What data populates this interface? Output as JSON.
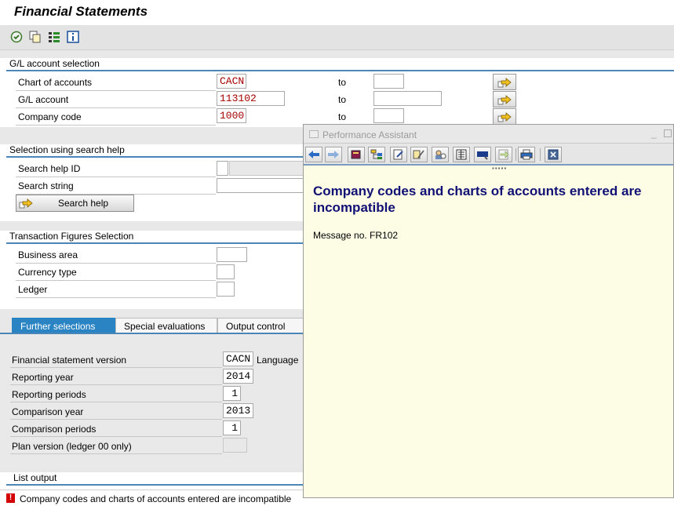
{
  "window": {
    "title": "Financial Statements"
  },
  "toolbar": {
    "icons": [
      "execute-icon",
      "copy-variant-icon",
      "tree-list-icon",
      "info-icon"
    ]
  },
  "gl_selection": {
    "title": "G/L account selection",
    "to_label": "to",
    "rows": [
      {
        "label": "Chart of accounts",
        "value": "CACN",
        "to_value": ""
      },
      {
        "label": "G/L account",
        "value": "113102",
        "to_value": ""
      },
      {
        "label": "Company code",
        "value": "1000",
        "to_value": ""
      }
    ]
  },
  "search_help": {
    "title": "Selection using search help",
    "id_label": "Search help ID",
    "string_label": "Search string",
    "button_label": "Search help"
  },
  "transaction_figures": {
    "title": "Transaction Figures Selection",
    "rows": [
      {
        "label": "Business area"
      },
      {
        "label": "Currency type"
      },
      {
        "label": "Ledger"
      }
    ]
  },
  "tabs": [
    {
      "label": "Further selections",
      "active": true
    },
    {
      "label": "Special evaluations",
      "active": false
    },
    {
      "label": "Output control",
      "active": false
    }
  ],
  "further_selections": {
    "language_label": "Language",
    "rows": [
      {
        "label": "Financial statement version",
        "value": "CACN"
      },
      {
        "label": "Reporting year",
        "value": "2014"
      },
      {
        "label": "Reporting periods",
        "value": "1"
      },
      {
        "label": "Comparison year",
        "value": "2013"
      },
      {
        "label": "Comparison periods",
        "value": "1"
      },
      {
        "label": "Plan version (ledger 00 only)",
        "value": ""
      }
    ]
  },
  "list_output": {
    "title": "List output"
  },
  "status_bar": {
    "icon": "error-icon",
    "text": "Company codes and charts of accounts entered are incompatible"
  },
  "performance_assistant": {
    "title": "Performance Assistant",
    "heading": "Company codes and charts of accounts entered are incompatible",
    "message_no": "Message no. FR102",
    "toolbar_icons": [
      "back-icon",
      "forward-icon",
      "book-icon",
      "tree-icon",
      "edit-icon",
      "notes-icon",
      "users-icon",
      "document-icon",
      "technical-info-icon",
      "export-icon",
      "print-icon",
      "close-icon"
    ]
  },
  "colors": {
    "accent": "#4a86b8",
    "active_tab": "#2a84c4",
    "heading": "#101075",
    "dialog_bg": "#fdfde6"
  }
}
